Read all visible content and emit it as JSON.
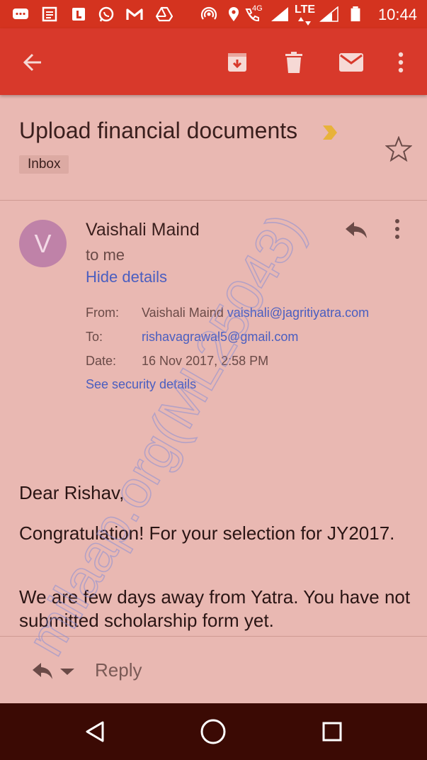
{
  "status_bar": {
    "time": "10:44",
    "network_4g": "4G",
    "network_lte": "LTE",
    "icons": [
      "messages-icon",
      "news-icon",
      "app-icon",
      "whatsapp-icon",
      "gmail-icon",
      "drive-icon",
      "hotspot-icon",
      "location-icon",
      "volte-call-icon",
      "signal-icon",
      "signal-icon",
      "battery-icon"
    ]
  },
  "toolbar": {
    "icons": [
      "back-arrow-icon",
      "archive-icon",
      "delete-icon",
      "mark-unread-icon",
      "more-vert-icon"
    ]
  },
  "email": {
    "subject": "Upload financial documents",
    "label": "Inbox",
    "sender_initial": "V",
    "sender_name": "Vaishali Maind",
    "to_me": "to me",
    "hide_details": "Hide details",
    "details": {
      "from_label": "From:",
      "from_name": "Vaishali Maind",
      "from_email": "vaishali@jagritiyatra.com",
      "to_label": "To:",
      "to_email": "rishavagrawal5@gmail.com",
      "date_label": "Date:",
      "date_value": "16 Nov 2017, 2:58 PM"
    },
    "security_link": "See security details",
    "body": [
      "Dear Rishav,",
      "Congratulation! For your selection for JY2017.",
      "We are few days away from Yatra. You have not submitted scholarship form yet."
    ]
  },
  "reply_bar": {
    "label": "Reply"
  },
  "watermark": "milaap.org(ML25043)",
  "colors": {
    "status_bar": "#d4331f",
    "app_bar": "#d8392b",
    "background": "#e9b8b2",
    "link": "#4a5ec0",
    "avatar": "#bf82a8",
    "nav_bar": "#3b0a04",
    "important_marker": "#e8b23a"
  }
}
